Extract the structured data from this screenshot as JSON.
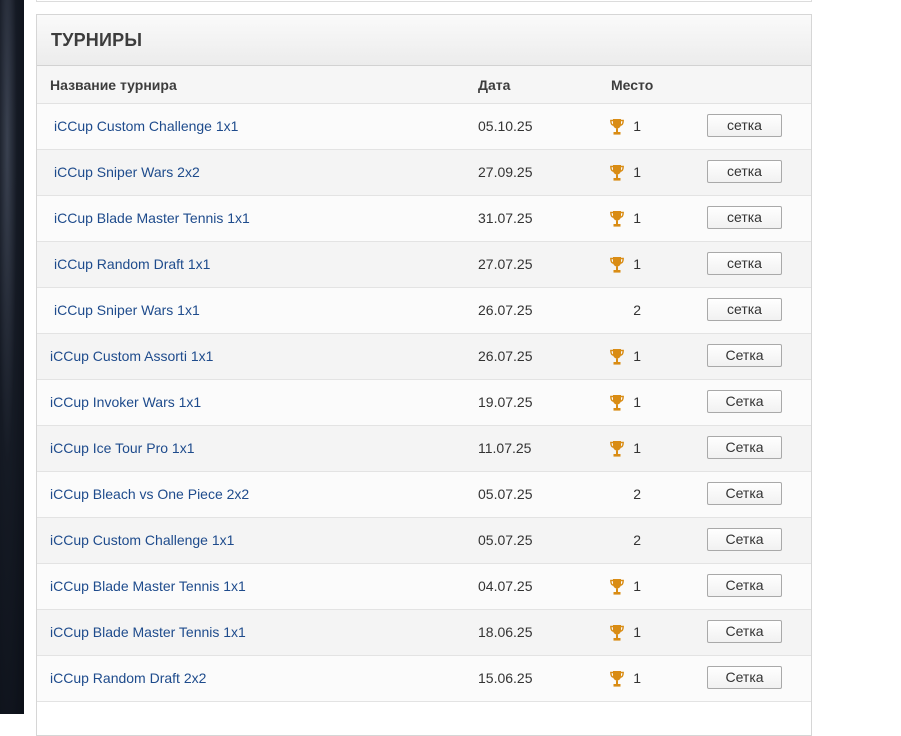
{
  "panel": {
    "title": "ТУРНИРЫ"
  },
  "columns": {
    "name": "Название турнира",
    "date": "Дата",
    "place": "Место"
  },
  "colors": {
    "link": "#1e4b8c",
    "trophy": "#d98c14"
  },
  "rows": [
    {
      "name": "iCCup Custom Challenge 1x1",
      "date": "05.10.25",
      "place": "1",
      "trophy": true,
      "button": "сетка"
    },
    {
      "name": "iCCup Sniper Wars 2x2",
      "date": "27.09.25",
      "place": "1",
      "trophy": true,
      "button": "сетка"
    },
    {
      "name": "iCCup Blade Master Tennis 1x1",
      "date": "31.07.25",
      "place": "1",
      "trophy": true,
      "button": "сетка"
    },
    {
      "name": "iCCup Random Draft 1x1",
      "date": "27.07.25",
      "place": "1",
      "trophy": true,
      "button": "сетка"
    },
    {
      "name": "iCCup Sniper Wars 1x1",
      "date": "26.07.25",
      "place": "2",
      "trophy": false,
      "button": "сетка"
    },
    {
      "name": "iCCup Custom Assorti 1x1",
      "date": "26.07.25",
      "place": "1",
      "trophy": true,
      "button": "Сетка"
    },
    {
      "name": "iCCup Invoker Wars 1x1",
      "date": "19.07.25",
      "place": "1",
      "trophy": true,
      "button": "Сетка"
    },
    {
      "name": "iCCup Ice Tour Pro 1x1",
      "date": "11.07.25",
      "place": "1",
      "trophy": true,
      "button": "Сетка"
    },
    {
      "name": "iCCup Bleach vs One Piece 2x2",
      "date": "05.07.25",
      "place": "2",
      "trophy": false,
      "button": "Сетка"
    },
    {
      "name": "iCCup Custom Challenge 1x1",
      "date": "05.07.25",
      "place": "2",
      "trophy": false,
      "button": "Сетка"
    },
    {
      "name": "iCCup Blade Master Tennis 1x1",
      "date": "04.07.25",
      "place": "1",
      "trophy": true,
      "button": "Сетка"
    },
    {
      "name": "iCCup Blade Master Tennis 1x1",
      "date": "18.06.25",
      "place": "1",
      "trophy": true,
      "button": "Сетка"
    },
    {
      "name": "iCCup Random Draft 2x2",
      "date": "15.06.25",
      "place": "1",
      "trophy": true,
      "button": "Сетка"
    }
  ]
}
